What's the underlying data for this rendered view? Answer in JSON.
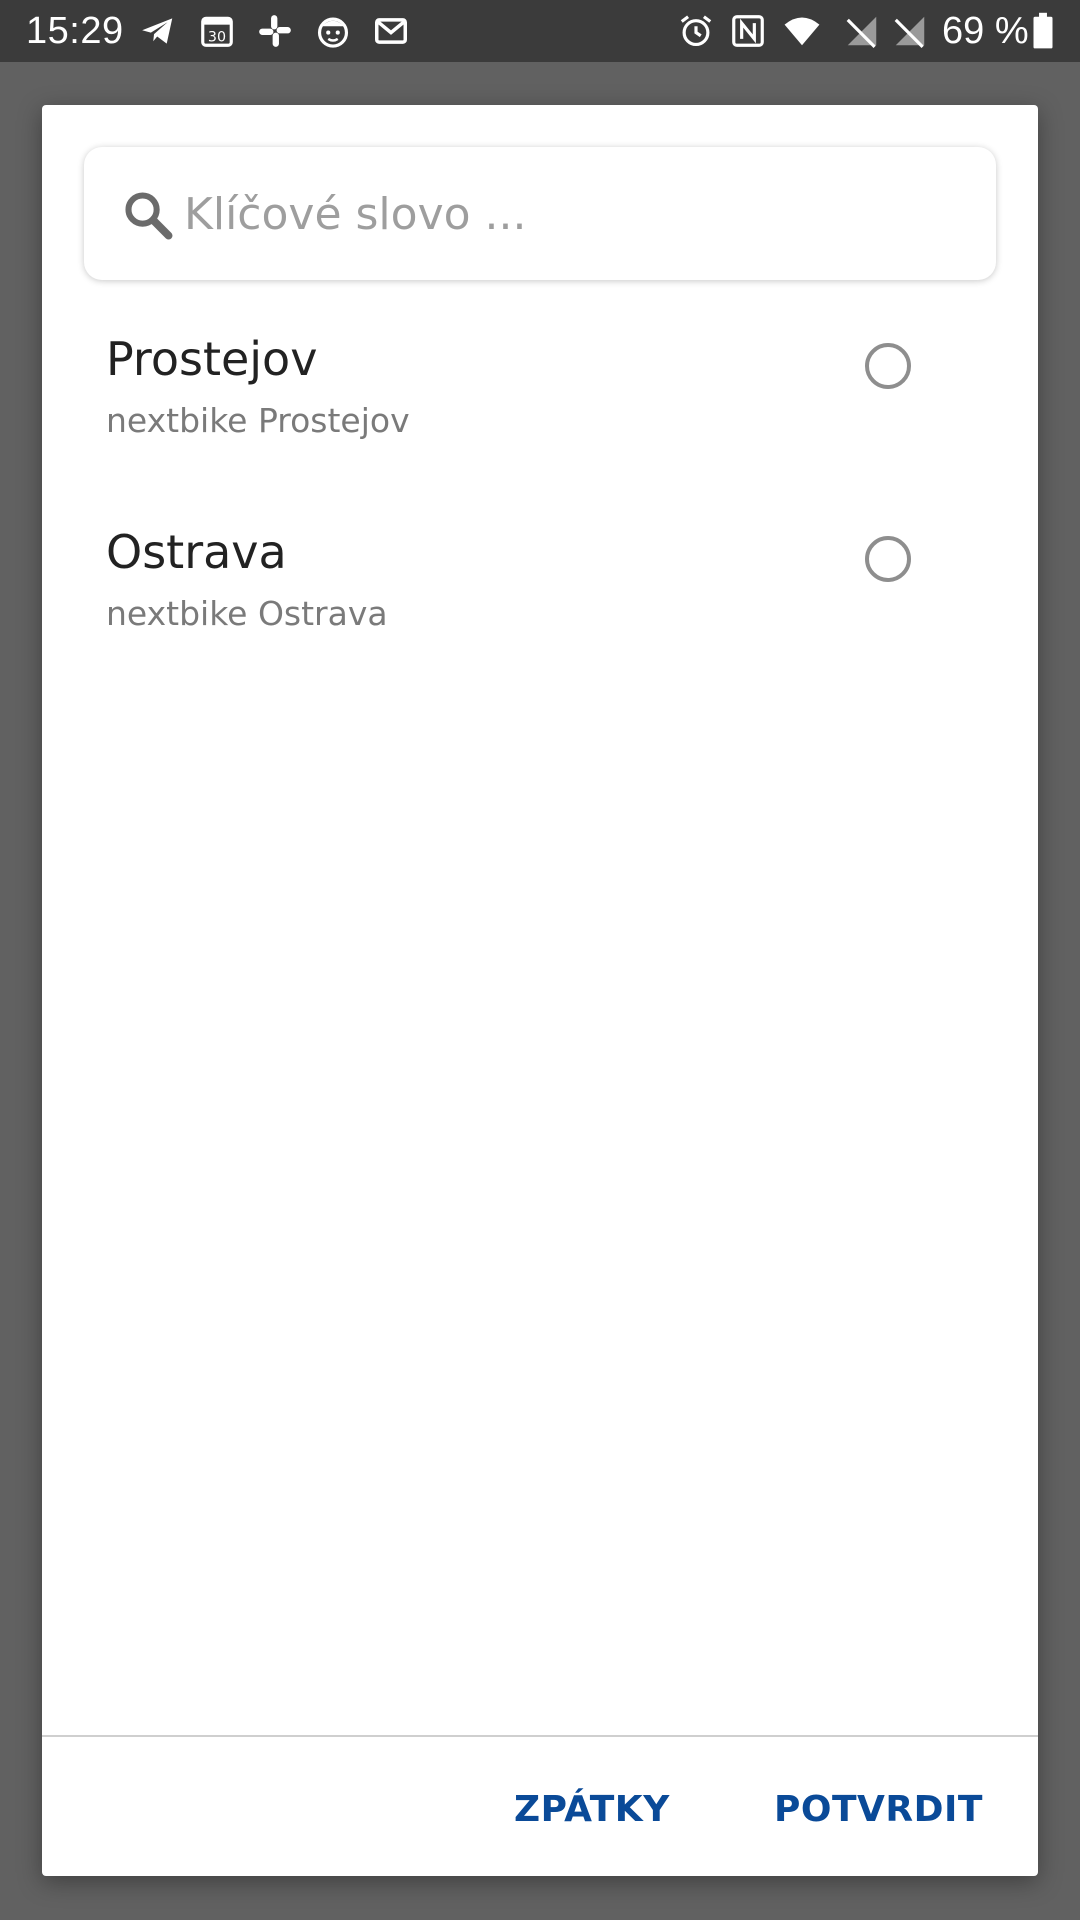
{
  "status_bar": {
    "time": "15:29",
    "battery_text": "69 %",
    "icons": [
      "telegram-icon",
      "calendar-icon",
      "slack-icon",
      "face-app-icon",
      "gmail-icon",
      "alarm-icon",
      "nfc-icon",
      "wifi-icon",
      "no-signal-icon",
      "no-signal-icon",
      "battery-icon"
    ],
    "calendar_day": "30"
  },
  "dialog": {
    "search": {
      "placeholder": "Klíčové slovo ...",
      "value": ""
    },
    "items": [
      {
        "title": "Prostejov",
        "subtitle": "nextbike Prostejov",
        "selected": false
      },
      {
        "title": "Ostrava",
        "subtitle": "nextbike Ostrava",
        "selected": false
      }
    ],
    "buttons": {
      "back_label": "ZPÁTKY",
      "confirm_label": "POTVRDIT"
    }
  },
  "colors": {
    "accent": "#0a4a98",
    "status_bar": "#3b3b3b",
    "scrim": "#616161"
  }
}
